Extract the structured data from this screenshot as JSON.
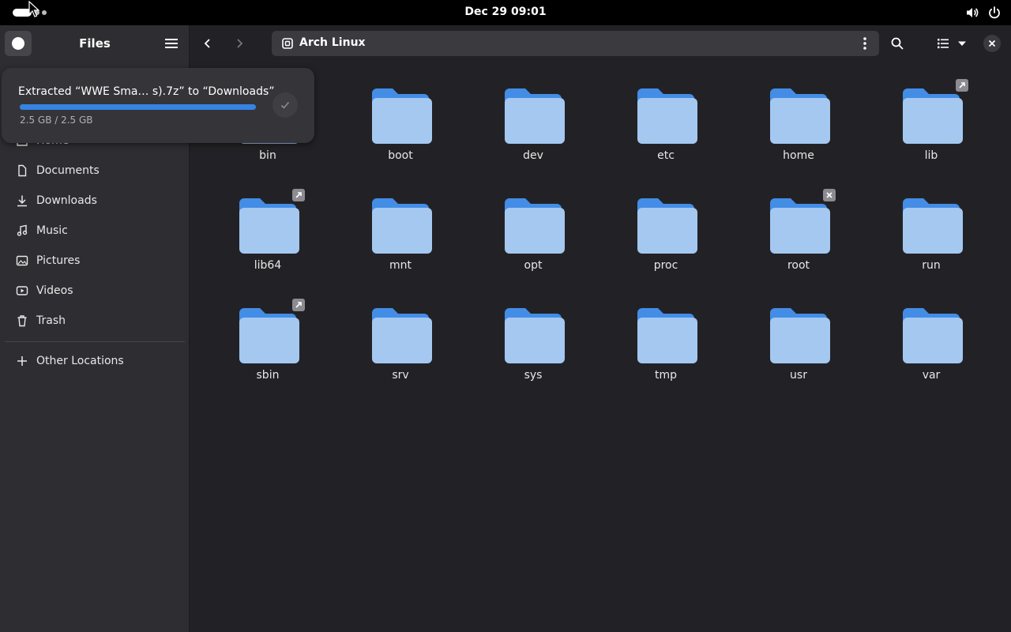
{
  "topbar": {
    "clock": "Dec 29  09:01",
    "tray_icons": [
      "volume-icon",
      "power-icon"
    ]
  },
  "sidebar": {
    "title": "Files",
    "items": [
      {
        "label": "Home",
        "icon": "home-icon"
      },
      {
        "label": "Documents",
        "icon": "document-icon"
      },
      {
        "label": "Downloads",
        "icon": "download-icon"
      },
      {
        "label": "Music",
        "icon": "music-icon"
      },
      {
        "label": "Pictures",
        "icon": "picture-icon"
      },
      {
        "label": "Videos",
        "icon": "video-icon"
      },
      {
        "label": "Trash",
        "icon": "trash-icon"
      }
    ],
    "other_locations": "Other Locations"
  },
  "toolbar": {
    "location": "Arch Linux"
  },
  "folders": [
    {
      "name": "bin",
      "emblem": "symlink"
    },
    {
      "name": "boot",
      "emblem": ""
    },
    {
      "name": "dev",
      "emblem": ""
    },
    {
      "name": "etc",
      "emblem": ""
    },
    {
      "name": "home",
      "emblem": ""
    },
    {
      "name": "lib",
      "emblem": "symlink"
    },
    {
      "name": "lib64",
      "emblem": "symlink"
    },
    {
      "name": "mnt",
      "emblem": ""
    },
    {
      "name": "opt",
      "emblem": ""
    },
    {
      "name": "proc",
      "emblem": ""
    },
    {
      "name": "root",
      "emblem": "unreadable"
    },
    {
      "name": "run",
      "emblem": ""
    },
    {
      "name": "sbin",
      "emblem": "symlink"
    },
    {
      "name": "srv",
      "emblem": ""
    },
    {
      "name": "sys",
      "emblem": ""
    },
    {
      "name": "tmp",
      "emblem": ""
    },
    {
      "name": "usr",
      "emblem": ""
    },
    {
      "name": "var",
      "emblem": ""
    }
  ],
  "notification": {
    "title": "Extracted “WWE Sma… s).7z” to “Downloads”",
    "progress": "2.5 GB / 2.5 GB",
    "progress_fraction": 1.0
  },
  "colors": {
    "accent": "#3584e4",
    "folder_body": "#a4c8f0",
    "folder_tab": "#438de6",
    "window_bg": "#222226",
    "sidebar_bg": "#2e2e32"
  }
}
